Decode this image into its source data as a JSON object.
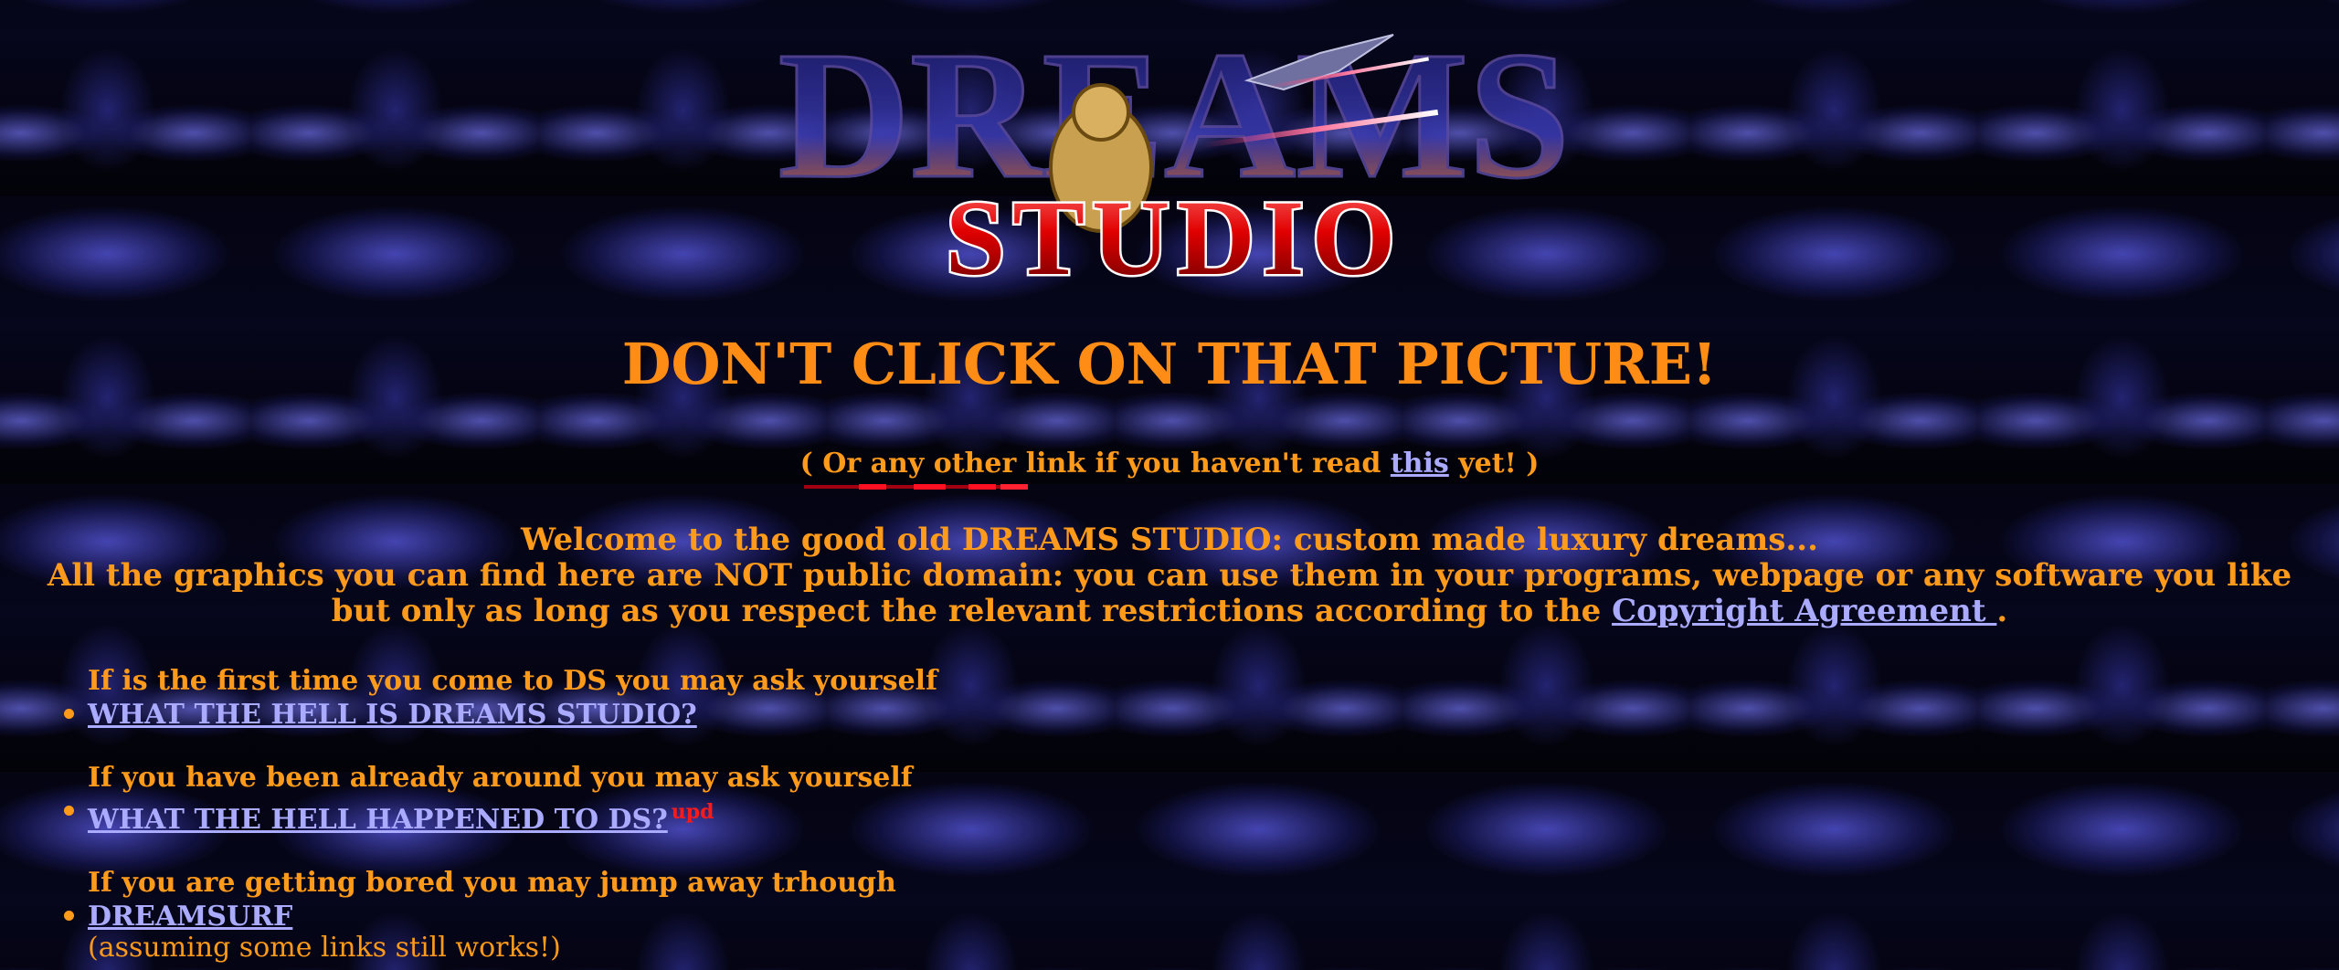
{
  "logo": {
    "top_text": "DREAMS",
    "bottom_text": "STUDIO"
  },
  "headline": "DON'T CLICK ON THAT PICTURE!",
  "subline": {
    "before": "( Or any other link if you haven't read ",
    "link": "this",
    "after": " yet! )"
  },
  "welcome": {
    "line1": "Welcome to the good old DREAMS STUDIO: custom made luxury dreams...",
    "line2": "All the graphics you can find here are NOT public domain: you can use them in your programs, webpage or any software you like but only as long as you respect the relevant restrictions according to the",
    "link": "Copyright Agreement ",
    "end": "."
  },
  "faq": [
    {
      "intro": "If is the first time you come to DS you may ask yourself",
      "link": "WHAT THE HELL IS DREAMS STUDIO?",
      "badge": "",
      "note": ""
    },
    {
      "intro": "If you have been already around you may ask yourself",
      "link": "WHAT THE HELL HAPPENED TO DS?",
      "badge": "upd",
      "note": ""
    },
    {
      "intro": "If you are getting bored you may jump away trhough",
      "link": "DREAMSURF",
      "badge": "",
      "note": "(assuming some links still works!)"
    }
  ],
  "colors": {
    "text": "#ff9a1a",
    "link": "#aaaaff",
    "badge": "#ff1a1a",
    "background": "#020208"
  }
}
